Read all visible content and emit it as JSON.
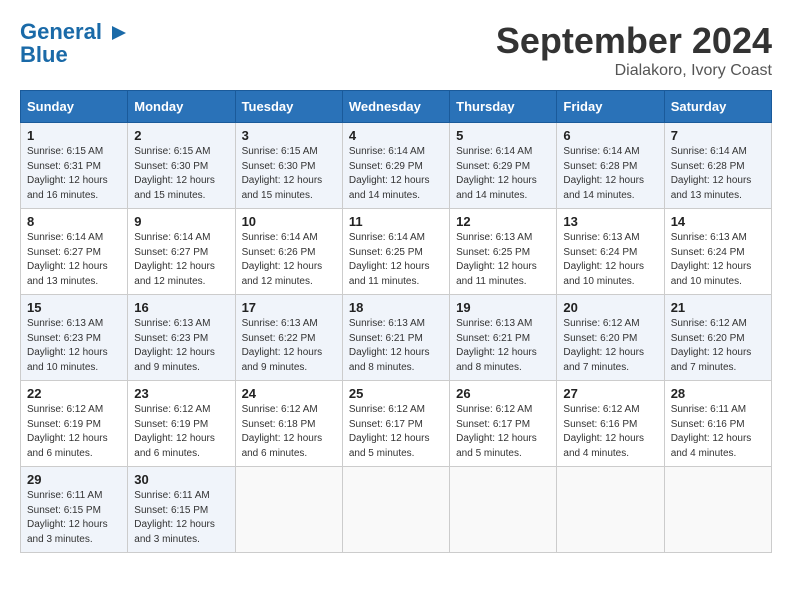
{
  "logo": {
    "line1": "General",
    "line2": "Blue",
    "icon": "▶"
  },
  "title": "September 2024",
  "subtitle": "Dialakoro, Ivory Coast",
  "days_of_week": [
    "Sunday",
    "Monday",
    "Tuesday",
    "Wednesday",
    "Thursday",
    "Friday",
    "Saturday"
  ],
  "weeks": [
    [
      {
        "day": "1",
        "sunrise": "6:15 AM",
        "sunset": "6:31 PM",
        "daylight": "12 hours and 16 minutes."
      },
      {
        "day": "2",
        "sunrise": "6:15 AM",
        "sunset": "6:30 PM",
        "daylight": "12 hours and 15 minutes."
      },
      {
        "day": "3",
        "sunrise": "6:15 AM",
        "sunset": "6:30 PM",
        "daylight": "12 hours and 15 minutes."
      },
      {
        "day": "4",
        "sunrise": "6:14 AM",
        "sunset": "6:29 PM",
        "daylight": "12 hours and 14 minutes."
      },
      {
        "day": "5",
        "sunrise": "6:14 AM",
        "sunset": "6:29 PM",
        "daylight": "12 hours and 14 minutes."
      },
      {
        "day": "6",
        "sunrise": "6:14 AM",
        "sunset": "6:28 PM",
        "daylight": "12 hours and 14 minutes."
      },
      {
        "day": "7",
        "sunrise": "6:14 AM",
        "sunset": "6:28 PM",
        "daylight": "12 hours and 13 minutes."
      }
    ],
    [
      {
        "day": "8",
        "sunrise": "6:14 AM",
        "sunset": "6:27 PM",
        "daylight": "12 hours and 13 minutes."
      },
      {
        "day": "9",
        "sunrise": "6:14 AM",
        "sunset": "6:27 PM",
        "daylight": "12 hours and 12 minutes."
      },
      {
        "day": "10",
        "sunrise": "6:14 AM",
        "sunset": "6:26 PM",
        "daylight": "12 hours and 12 minutes."
      },
      {
        "day": "11",
        "sunrise": "6:14 AM",
        "sunset": "6:25 PM",
        "daylight": "12 hours and 11 minutes."
      },
      {
        "day": "12",
        "sunrise": "6:13 AM",
        "sunset": "6:25 PM",
        "daylight": "12 hours and 11 minutes."
      },
      {
        "day": "13",
        "sunrise": "6:13 AM",
        "sunset": "6:24 PM",
        "daylight": "12 hours and 10 minutes."
      },
      {
        "day": "14",
        "sunrise": "6:13 AM",
        "sunset": "6:24 PM",
        "daylight": "12 hours and 10 minutes."
      }
    ],
    [
      {
        "day": "15",
        "sunrise": "6:13 AM",
        "sunset": "6:23 PM",
        "daylight": "12 hours and 10 minutes."
      },
      {
        "day": "16",
        "sunrise": "6:13 AM",
        "sunset": "6:23 PM",
        "daylight": "12 hours and 9 minutes."
      },
      {
        "day": "17",
        "sunrise": "6:13 AM",
        "sunset": "6:22 PM",
        "daylight": "12 hours and 9 minutes."
      },
      {
        "day": "18",
        "sunrise": "6:13 AM",
        "sunset": "6:21 PM",
        "daylight": "12 hours and 8 minutes."
      },
      {
        "day": "19",
        "sunrise": "6:13 AM",
        "sunset": "6:21 PM",
        "daylight": "12 hours and 8 minutes."
      },
      {
        "day": "20",
        "sunrise": "6:12 AM",
        "sunset": "6:20 PM",
        "daylight": "12 hours and 7 minutes."
      },
      {
        "day": "21",
        "sunrise": "6:12 AM",
        "sunset": "6:20 PM",
        "daylight": "12 hours and 7 minutes."
      }
    ],
    [
      {
        "day": "22",
        "sunrise": "6:12 AM",
        "sunset": "6:19 PM",
        "daylight": "12 hours and 6 minutes."
      },
      {
        "day": "23",
        "sunrise": "6:12 AM",
        "sunset": "6:19 PM",
        "daylight": "12 hours and 6 minutes."
      },
      {
        "day": "24",
        "sunrise": "6:12 AM",
        "sunset": "6:18 PM",
        "daylight": "12 hours and 6 minutes."
      },
      {
        "day": "25",
        "sunrise": "6:12 AM",
        "sunset": "6:17 PM",
        "daylight": "12 hours and 5 minutes."
      },
      {
        "day": "26",
        "sunrise": "6:12 AM",
        "sunset": "6:17 PM",
        "daylight": "12 hours and 5 minutes."
      },
      {
        "day": "27",
        "sunrise": "6:12 AM",
        "sunset": "6:16 PM",
        "daylight": "12 hours and 4 minutes."
      },
      {
        "day": "28",
        "sunrise": "6:11 AM",
        "sunset": "6:16 PM",
        "daylight": "12 hours and 4 minutes."
      }
    ],
    [
      {
        "day": "29",
        "sunrise": "6:11 AM",
        "sunset": "6:15 PM",
        "daylight": "12 hours and 3 minutes."
      },
      {
        "day": "30",
        "sunrise": "6:11 AM",
        "sunset": "6:15 PM",
        "daylight": "12 hours and 3 minutes."
      },
      null,
      null,
      null,
      null,
      null
    ]
  ]
}
